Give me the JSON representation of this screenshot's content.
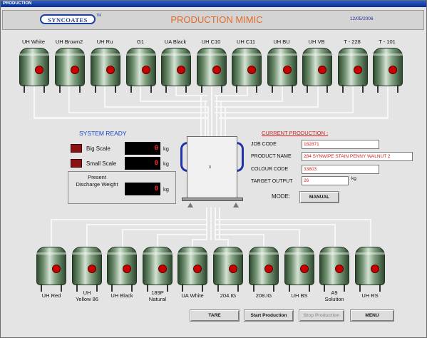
{
  "window": {
    "title": "PRODUCTION"
  },
  "header": {
    "logo": "SYNCOATES",
    "trademark": "TM",
    "title": "PRODUCTION MIMIC",
    "date": "12/05/2006"
  },
  "top_tanks": [
    "UH White",
    "UH Brown2",
    "UH Ru",
    "G1",
    "UA Black",
    "UH C10",
    "UH C11",
    "UH BU",
    "UH VB",
    "T - 228",
    "T - 101"
  ],
  "bottom_tanks": [
    "UH Red",
    "UH\nYellow 86",
    "UH Black",
    "189P\nNatural",
    "UA White",
    "204.IG",
    "208.IG",
    "UH BS",
    "A9\nSolution",
    "UH RS"
  ],
  "status": {
    "system": "SYSTEM READY"
  },
  "scales": {
    "big": {
      "label": "Big Scale",
      "value": "0",
      "unit": "kg"
    },
    "small": {
      "label": "Small Scale",
      "value": "0",
      "unit": "kg"
    },
    "discharge": {
      "label": "Present Discharge Weight",
      "value": "0",
      "unit": "kg"
    }
  },
  "hopper": {
    "value": "0"
  },
  "current_production": {
    "title": "CURRENT PRODUCTION :",
    "job_code_label": "JOB CODE",
    "job_code": "182871",
    "product_name_label": "PRODUCT NAME",
    "product_name": "284 SYNWIPE STAIN PENNY WALNUT 2",
    "colour_code_label": "COLOUR CODE",
    "colour_code": "33803",
    "target_output_label": "TARGET OUTPUT",
    "target_output": "26",
    "target_unit": "kg"
  },
  "mode": {
    "label": "MODE:",
    "button": "MANUAL"
  },
  "buttons": {
    "tare": "TARE",
    "start": "Start Production",
    "stop": "Stop Production",
    "menu": "MENU"
  }
}
